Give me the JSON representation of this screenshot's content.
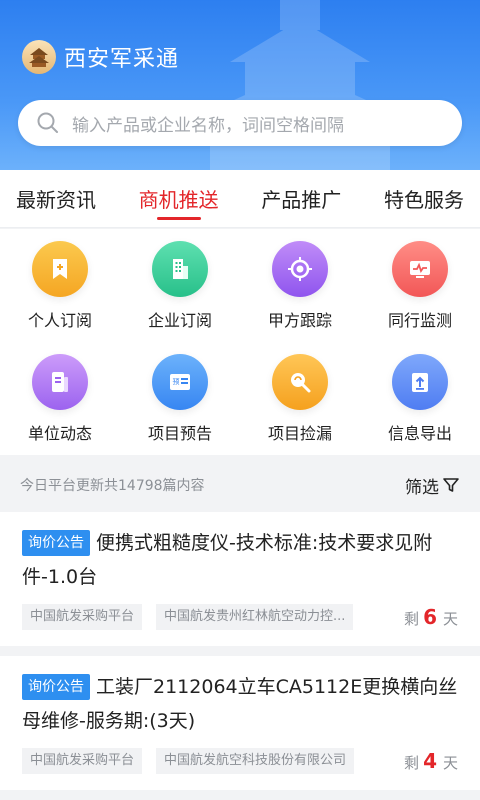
{
  "header": {
    "app_title": "西安军采通",
    "search_placeholder": "输入产品或企业名称，词间空格间隔"
  },
  "tabs": [
    {
      "label": "最新资讯",
      "active": false
    },
    {
      "label": "商机推送",
      "active": true
    },
    {
      "label": "产品推广",
      "active": false
    },
    {
      "label": "特色服务",
      "active": false
    }
  ],
  "grid": [
    {
      "label": "个人订阅",
      "icon": "bookmark-plus-icon",
      "color": "#f6b02c"
    },
    {
      "label": "企业订阅",
      "icon": "building-icon",
      "color": "#3ccb9c"
    },
    {
      "label": "甲方跟踪",
      "icon": "target-icon",
      "color": "#a268f2"
    },
    {
      "label": "同行监测",
      "icon": "monitor-chart-icon",
      "color": "#f66b6b"
    },
    {
      "label": "单位动态",
      "icon": "document-icon",
      "color": "#b07af4"
    },
    {
      "label": "项目预告",
      "icon": "preview-list-icon",
      "color": "#4a97f6"
    },
    {
      "label": "项目捡漏",
      "icon": "magnifier-icon",
      "color": "#f7ae31"
    },
    {
      "label": "信息导出",
      "icon": "export-icon",
      "color": "#5f8ef5"
    }
  ],
  "info": {
    "count_text": "今日平台更新共14798篇内容",
    "filter_label": "筛选"
  },
  "cards": [
    {
      "tag": "询价公告",
      "title": "便携式粗糙度仪-技术标准:技术要求见附件-1.0台",
      "sources": [
        "中国航发采购平台",
        "中国航发贵州红林航空动力控..."
      ],
      "remain_prefix": "剩",
      "remain_days": "6",
      "remain_suffix": "天"
    },
    {
      "tag": "询价公告",
      "title": "工装厂2112064立车CA5112E更换横向丝母维修-服务期:(3天)",
      "sources": [
        "中国航发采购平台",
        "中国航发航空科技股份有限公司"
      ],
      "remain_prefix": "剩",
      "remain_days": "4",
      "remain_suffix": "天"
    }
  ],
  "colors": {
    "header_blue": "#2d7ff0",
    "accent_red": "#e3262a",
    "tag_blue": "#2e8ff0"
  }
}
